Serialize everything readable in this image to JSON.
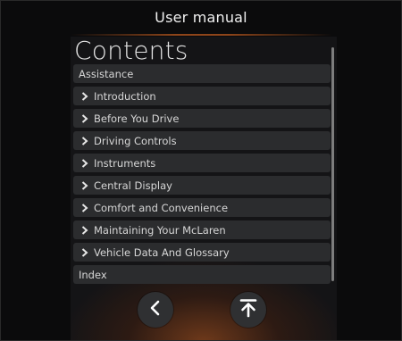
{
  "header": {
    "title": "User manual"
  },
  "contents": {
    "heading": "Contents",
    "items": [
      {
        "label": "Assistance",
        "expandable": false
      },
      {
        "label": "Introduction",
        "expandable": true
      },
      {
        "label": "Before You Drive",
        "expandable": true
      },
      {
        "label": "Driving Controls",
        "expandable": true
      },
      {
        "label": "Instruments",
        "expandable": true
      },
      {
        "label": "Central Display",
        "expandable": true
      },
      {
        "label": "Comfort and Convenience",
        "expandable": true
      },
      {
        "label": "Maintaining Your McLaren",
        "expandable": true
      },
      {
        "label": "Vehicle Data And Glossary",
        "expandable": true
      },
      {
        "label": "Index",
        "expandable": false
      }
    ]
  },
  "navigation": {
    "back_icon": "chevron-left-icon",
    "top_icon": "scroll-to-top-icon"
  },
  "colors": {
    "background": "#0b0b0c",
    "panel": "#141416",
    "item": "#2b2c2e",
    "accent": "#b9581e",
    "text": "#d6d6d6"
  }
}
